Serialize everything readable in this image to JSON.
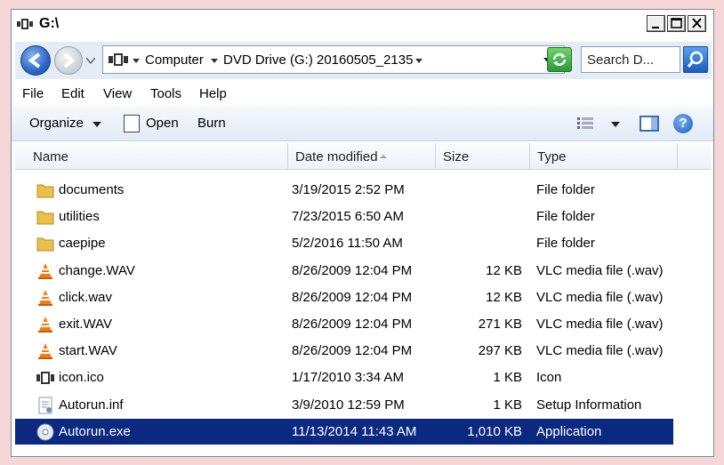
{
  "window": {
    "title": "G:\\"
  },
  "address": {
    "crumbs": [
      "Computer",
      "DVD Drive (G:) 20160505_2135"
    ],
    "search_placeholder": "Search D..."
  },
  "menu": [
    "File",
    "Edit",
    "View",
    "Tools",
    "Help"
  ],
  "toolbar": {
    "organize": "Organize",
    "open": "Open",
    "burn": "Burn"
  },
  "columns": [
    "Name",
    "Date modified",
    "Size",
    "Type"
  ],
  "files": [
    {
      "name": "documents",
      "date": "3/19/2015 2:52 PM",
      "size": "",
      "type": "File folder",
      "icon": "folder-icon"
    },
    {
      "name": "utilities",
      "date": "7/23/2015 6:50 AM",
      "size": "",
      "type": "File folder",
      "icon": "folder-icon"
    },
    {
      "name": "caepipe",
      "date": "5/2/2016 11:50 AM",
      "size": "",
      "type": "File folder",
      "icon": "folder-icon"
    },
    {
      "name": "change.WAV",
      "date": "8/26/2009 12:04 PM",
      "size": "12 KB",
      "type": "VLC media file (.wav)",
      "icon": "vlc-cone-icon"
    },
    {
      "name": "click.wav",
      "date": "8/26/2009 12:04 PM",
      "size": "12 KB",
      "type": "VLC media file (.wav)",
      "icon": "vlc-cone-icon"
    },
    {
      "name": "exit.WAV",
      "date": "8/26/2009 12:04 PM",
      "size": "271 KB",
      "type": "VLC media file (.wav)",
      "icon": "vlc-cone-icon"
    },
    {
      "name": "start.WAV",
      "date": "8/26/2009 12:04 PM",
      "size": "297 KB",
      "type": "VLC media file (.wav)",
      "icon": "vlc-cone-icon"
    },
    {
      "name": "icon.ico",
      "date": "1/17/2010 3:34 AM",
      "size": "1 KB",
      "type": "Icon",
      "icon": "ico-file-icon"
    },
    {
      "name": "Autorun.inf",
      "date": "3/9/2010 12:59 PM",
      "size": "1 KB",
      "type": "Setup Information",
      "icon": "setup-file-icon"
    },
    {
      "name": "Autorun.exe",
      "date": "11/13/2014 11:43 AM",
      "size": "1,010 KB",
      "type": "Application",
      "icon": "disc-app-icon",
      "selected": true
    }
  ],
  "colors": {
    "selection": "#0b2980",
    "folder": "#e8c04a",
    "vlc": "#f07e18"
  }
}
